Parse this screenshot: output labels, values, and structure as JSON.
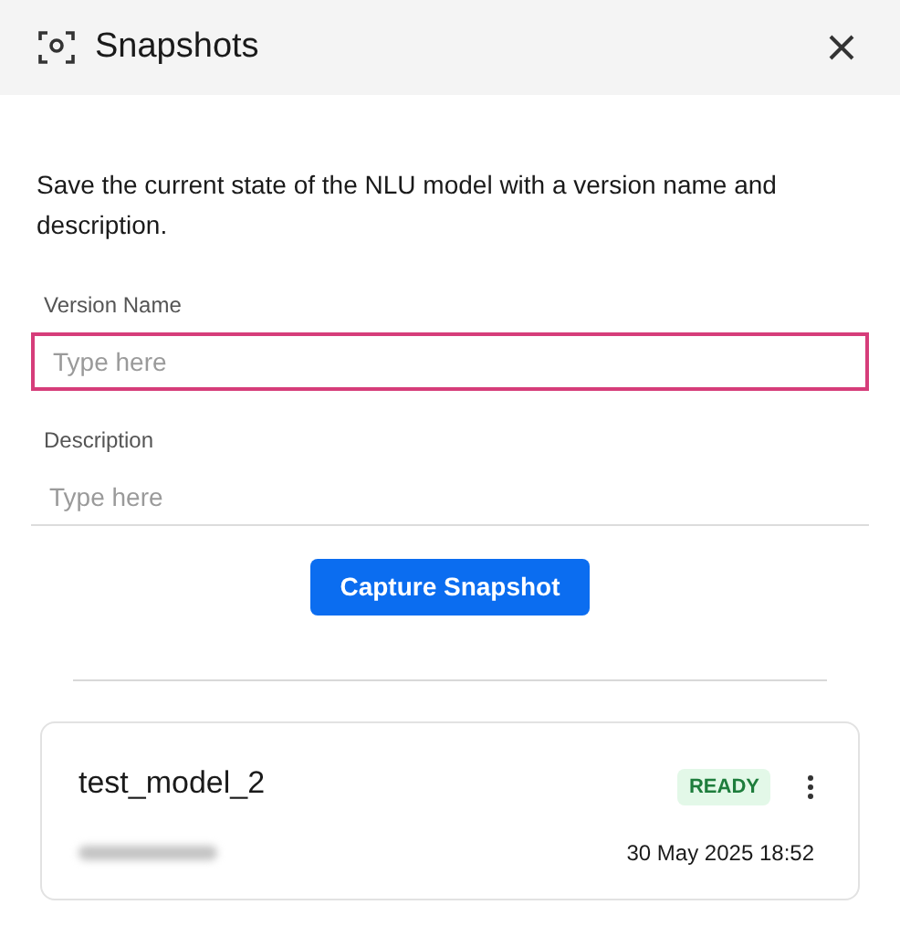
{
  "window": {
    "title": "Snapshots"
  },
  "intro": "Save the current state of the NLU model with a version name and description.",
  "fields": [
    {
      "label": "Version Name",
      "placeholder": "Type here",
      "focused": true
    },
    {
      "label": "Description",
      "placeholder": "Type here",
      "focused": false
    }
  ],
  "capture_button": "Capture Snapshot",
  "snapshots": [
    {
      "name": "test_model_2",
      "status": {
        "kind": "ready",
        "label": "READY"
      },
      "created": "30 May 2025 18:52"
    }
  ]
}
